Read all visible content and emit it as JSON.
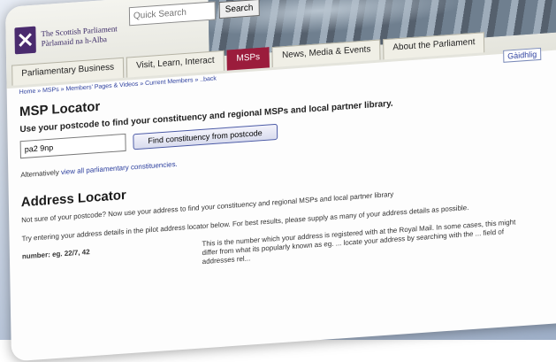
{
  "header": {
    "logo_line1": "The Scottish Parliament",
    "logo_line2": "Pàrlamaid na h-Alba",
    "quick_search_placeholder": "Quick Search",
    "search_button": "Search"
  },
  "tabs": [
    {
      "label": "Parliamentary Business"
    },
    {
      "label": "Visit, Learn, Interact"
    },
    {
      "label": "MSPs"
    },
    {
      "label": "News, Media & Events"
    },
    {
      "label": "About the Parliament"
    }
  ],
  "breadcrumb": "Home » MSPs » Members' Pages & Videos » Current Members » ..back",
  "lang_link": "Gàidhlig",
  "msp_locator": {
    "title": "MSP Locator",
    "instruction": "Use your postcode to find your constituency and regional MSPs and local partner library.",
    "postcode_value": "pa2 9np",
    "find_button": "Find constituency from postcode",
    "alt_prefix": "Alternatively",
    "alt_link": "view all parliamentary constituencies."
  },
  "address_locator": {
    "title": "Address Locator",
    "para1": "Not sure of your postcode? Now use your address to find your constituency and regional MSPs and local partner library",
    "para2": "Try entering your address details in the pilot address locator below. For best results, please supply as many of your address details as possible.",
    "number_label": "number: eg. 22/7, 42",
    "number_help": "This is the number which your address is registered with at the Royal Mail. In some cases, this might differ from what its popularly known as eg. ... locate your address by searching with the ... field of addresses rel..."
  }
}
